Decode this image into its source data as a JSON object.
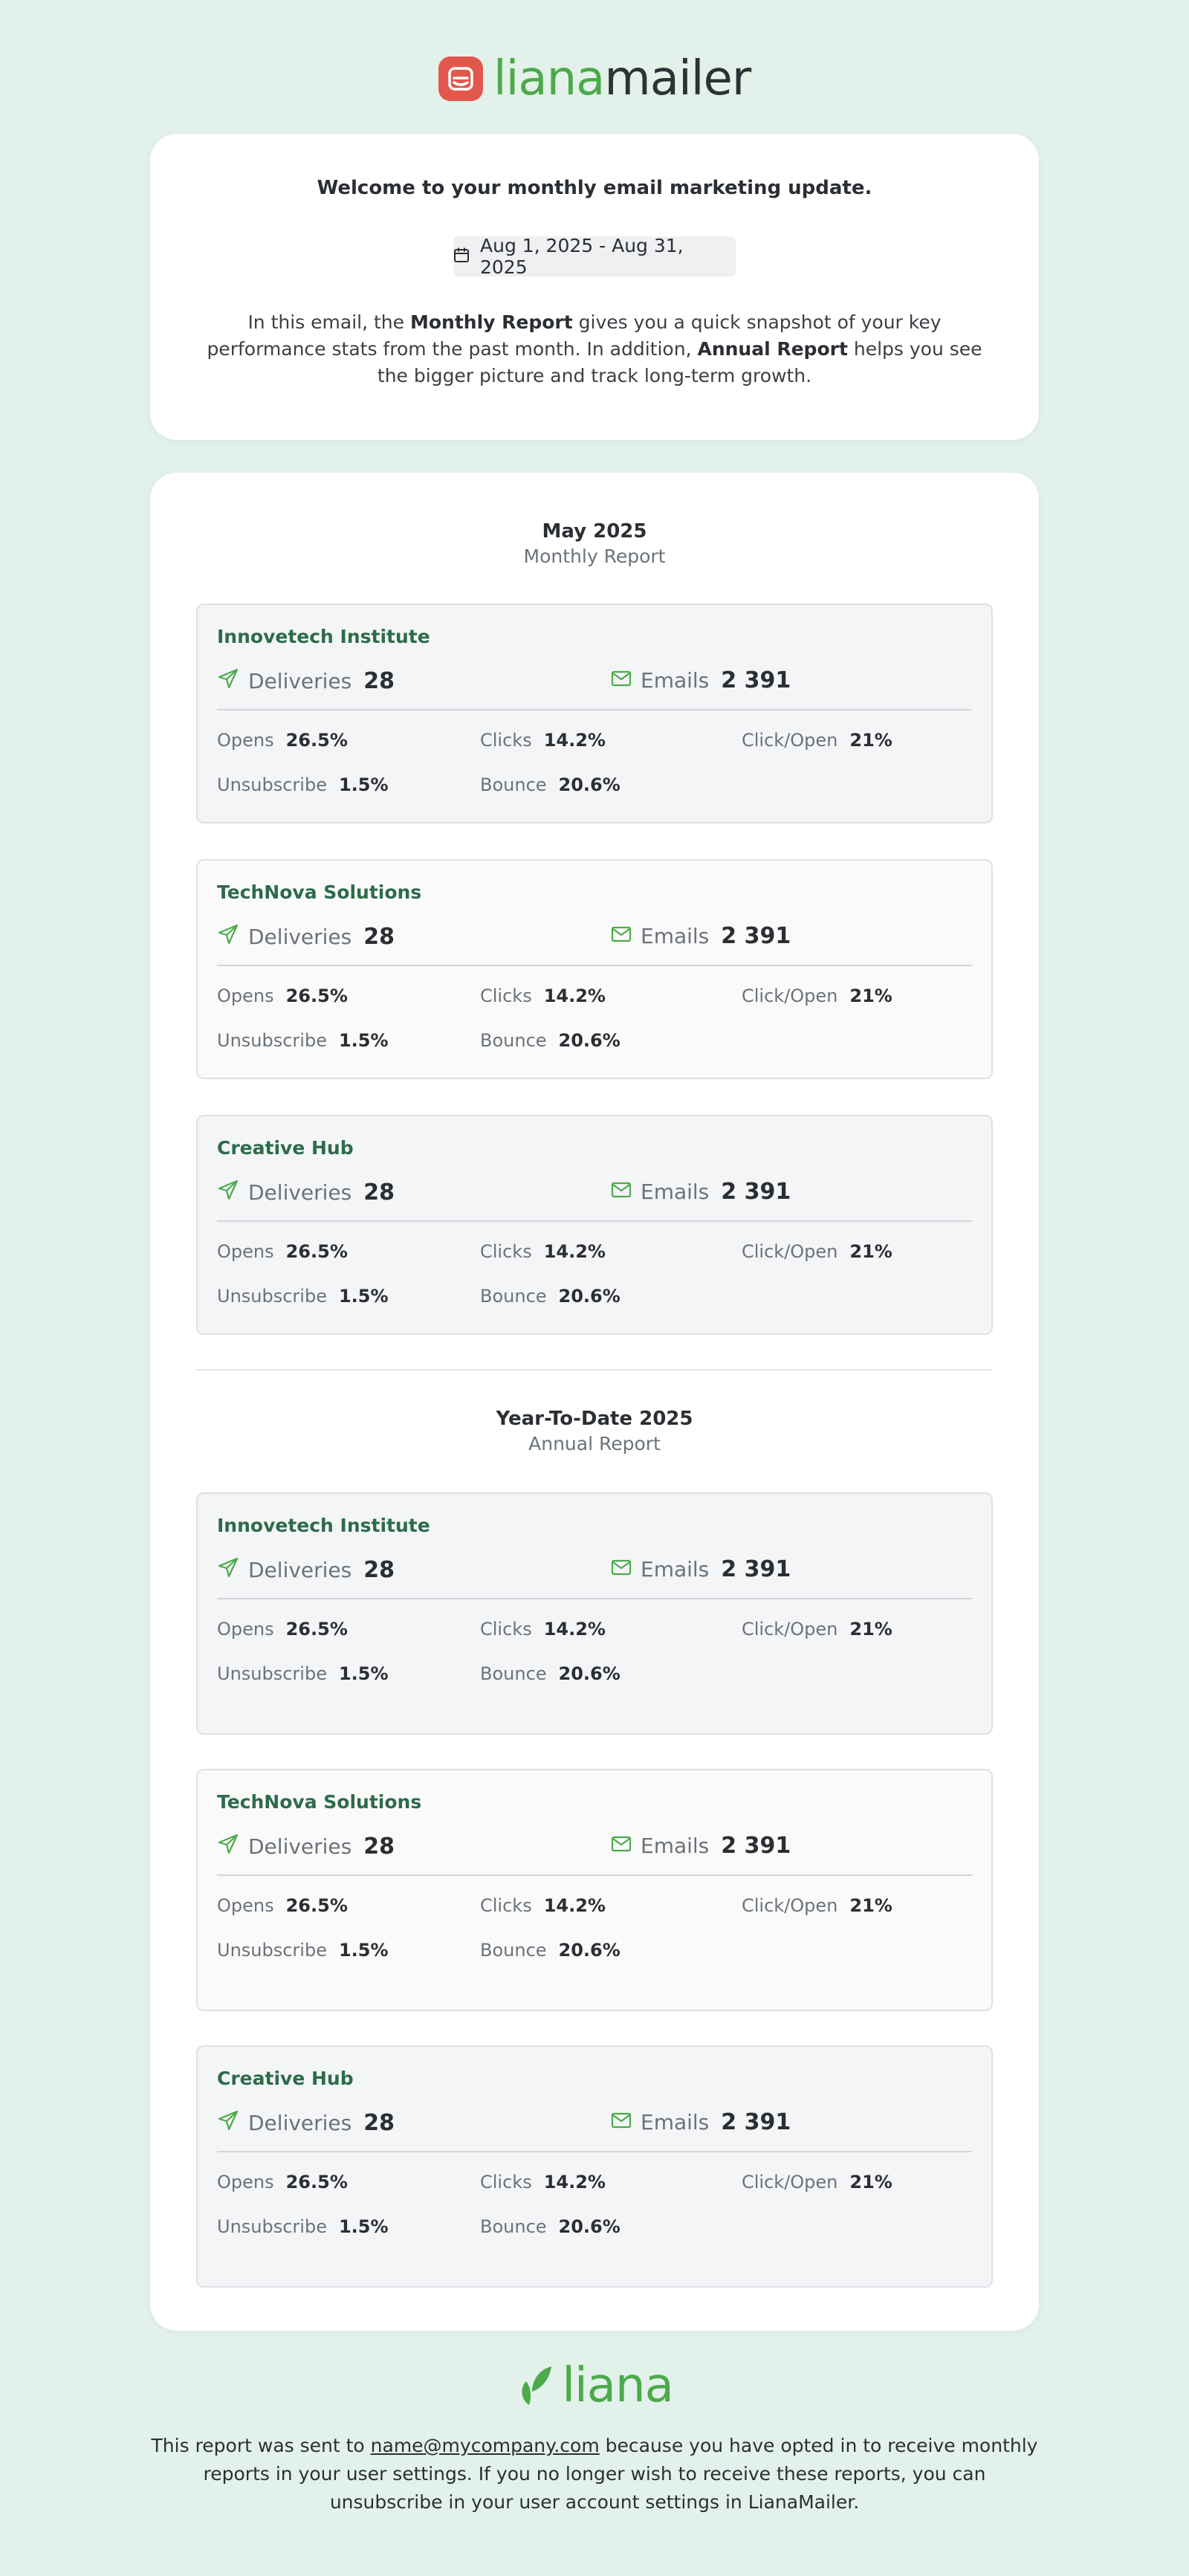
{
  "brand": {
    "logo_part1": "liana",
    "logo_part2": "mailer",
    "footer_logo": "liana"
  },
  "welcome": {
    "title": "Welcome to your monthly email marketing update.",
    "date_range": "Aug 1, 2025 - Aug 31, 2025",
    "intro_pre": "In this email, the ",
    "intro_b1": "Monthly Report",
    "intro_mid": " gives you a quick snapshot of your key performance stats from the past month. In addition, ",
    "intro_b2": "Annual Report",
    "intro_post": " helps you see the bigger picture and track long-term growth."
  },
  "labels": {
    "deliveries": "Deliveries",
    "emails": "Emails",
    "opens": "Opens",
    "clicks": "Clicks",
    "click_open": "Click/Open",
    "unsubscribe": "Unsubscribe",
    "bounce": "Bounce"
  },
  "monthly": {
    "title": "May 2025",
    "subtitle": "Monthly Report",
    "orgs": [
      {
        "name": "Innovetech Institute",
        "deliveries": "28",
        "emails": "2 391",
        "opens": "26.5%",
        "clicks": "14.2%",
        "click_open": "21%",
        "unsubscribe": "1.5%",
        "bounce": "20.6%"
      },
      {
        "name": "TechNova Solutions",
        "deliveries": "28",
        "emails": "2 391",
        "opens": "26.5%",
        "clicks": "14.2%",
        "click_open": "21%",
        "unsubscribe": "1.5%",
        "bounce": "20.6%"
      },
      {
        "name": "Creative Hub",
        "deliveries": "28",
        "emails": "2 391",
        "opens": "26.5%",
        "clicks": "14.2%",
        "click_open": "21%",
        "unsubscribe": "1.5%",
        "bounce": "20.6%"
      }
    ]
  },
  "annual": {
    "title": "Year-To-Date 2025",
    "subtitle": "Annual Report",
    "orgs": [
      {
        "name": "Innovetech Institute",
        "deliveries": "28",
        "emails": "2 391",
        "opens": "26.5%",
        "clicks": "14.2%",
        "click_open": "21%",
        "unsubscribe": "1.5%",
        "bounce": "20.6%"
      },
      {
        "name": "TechNova Solutions",
        "deliveries": "28",
        "emails": "2 391",
        "opens": "26.5%",
        "clicks": "14.2%",
        "click_open": "21%",
        "unsubscribe": "1.5%",
        "bounce": "20.6%"
      },
      {
        "name": "Creative Hub",
        "deliveries": "28",
        "emails": "2 391",
        "opens": "26.5%",
        "clicks": "14.2%",
        "click_open": "21%",
        "unsubscribe": "1.5%",
        "bounce": "20.6%"
      }
    ]
  },
  "footer": {
    "text_pre": "This report was sent to ",
    "email": "name@mycompany.com",
    "text_post": " because you have opted in to receive monthly reports in your user settings. If you no longer wish to receive these reports, you can unsubscribe in your user account settings in LianaMailer."
  },
  "colors": {
    "background": "#e2f2ea",
    "brand_green": "#4caa4b",
    "brand_red": "#e2574c",
    "org_name": "#2d6b4b"
  }
}
